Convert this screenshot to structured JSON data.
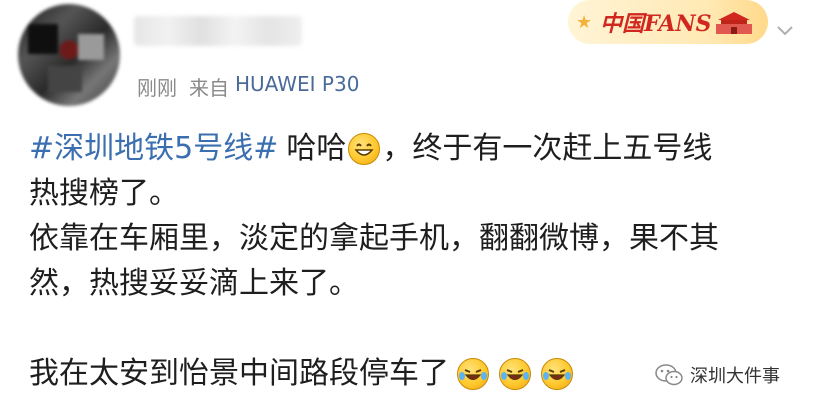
{
  "header": {
    "timestamp": "刚刚",
    "from_label": "来自",
    "device": "HUAWEI P30"
  },
  "badge": {
    "text": "中国FANS"
  },
  "content": {
    "hashtag": "#深圳地铁5号线#",
    "line1_a": "哈哈",
    "line1_b": "，终于有一次赶上五号线",
    "line2": "热搜榜了。",
    "line3": "依靠在车厢里，淡定的拿起手机，翻翻微博，果不其",
    "line4": "然，热搜妥妥滴上来了。",
    "line6": "我在太安到怡景中间路段停车了"
  },
  "watermark": {
    "text": "深圳大件事"
  },
  "colors": {
    "hashtag": "#3b6fb0",
    "device": "#4a6a9a",
    "meta": "#8a8a8a"
  }
}
